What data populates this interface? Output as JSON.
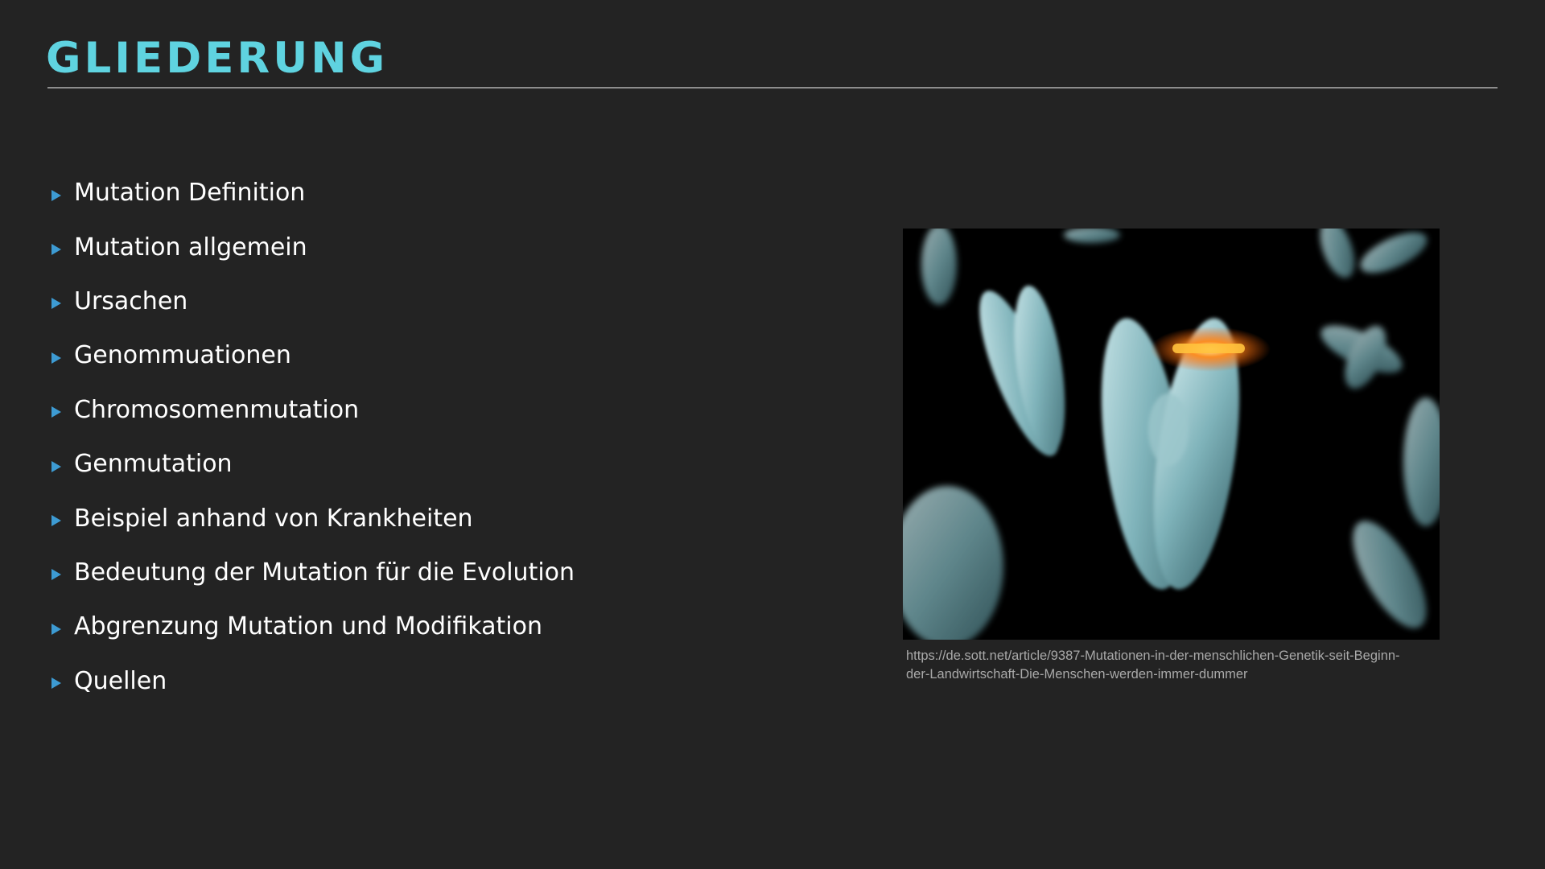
{
  "slide": {
    "title": "GLIEDERUNG",
    "outline_items": [
      {
        "label": "Mutation Definition"
      },
      {
        "label": "Mutation allgemein"
      },
      {
        "label": "Ursachen"
      },
      {
        "label": "Genommuationen"
      },
      {
        "label": "Chromosomenmutation"
      },
      {
        "label": "Genmutation"
      },
      {
        "label": "Beispiel anhand von Krankheiten"
      },
      {
        "label": "Bedeutung der Mutation für die Evolution"
      },
      {
        "label": "Abgrenzung Mutation und Modifikation"
      },
      {
        "label": "Quellen"
      }
    ],
    "image": {
      "caption_line1": "https://de.sott.net/article/9387-Mutationen-in-der-menschlichen-Genetik-seit-Beginn-",
      "caption_line2": "der-Landwirtschaft-Die-Menschen-werden-immer-dummer"
    }
  },
  "colors": {
    "background": "#232323",
    "title": "#5fd3e0",
    "rule": "#8d8d8d",
    "bullet": "#3d9bd3",
    "text": "#ffffff",
    "caption": "#a9a9a9"
  },
  "icons": {
    "bullet": "triangle-right-icon"
  }
}
